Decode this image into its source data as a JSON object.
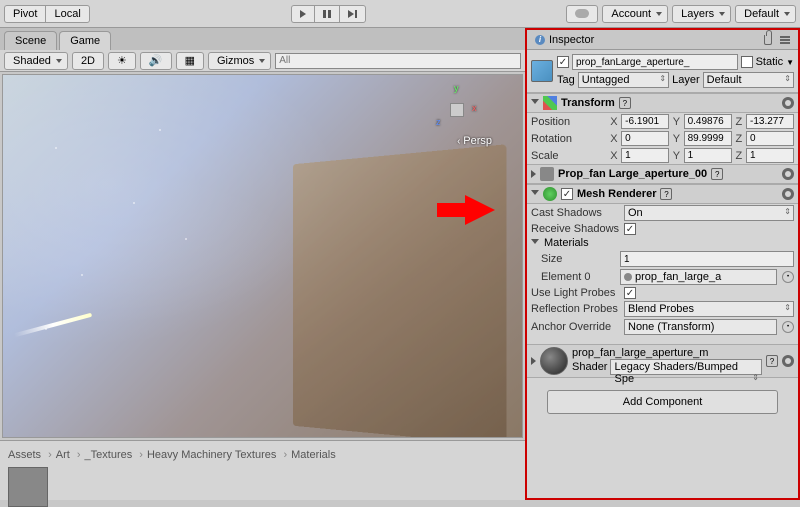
{
  "toolbar": {
    "pivot": "Pivot",
    "local": "Local",
    "account": "Account",
    "layers": "Layers",
    "layout": "Default"
  },
  "tabs": {
    "scene": "Scene",
    "game": "Game",
    "inspector": "Inspector"
  },
  "sceneBar": {
    "shaded": "Shaded",
    "mode2d": "2D",
    "gizmos": "Gizmos",
    "search": "All"
  },
  "viewport": {
    "persp": "Persp",
    "axes": {
      "x": "x",
      "y": "y",
      "z": "z"
    }
  },
  "breadcrumb": [
    "Assets",
    "Art",
    "_Textures",
    "Heavy Machinery Textures",
    "Materials"
  ],
  "inspector": {
    "object": {
      "enabled": true,
      "name": "prop_fanLarge_aperture_",
      "static_label": "Static",
      "static": false,
      "tag_label": "Tag",
      "tag": "Untagged",
      "layer_label": "Layer",
      "layer": "Default"
    },
    "transform": {
      "title": "Transform",
      "position_label": "Position",
      "position": {
        "x": "-6.1901",
        "y": "0.49876",
        "z": "-13.277"
      },
      "rotation_label": "Rotation",
      "rotation": {
        "x": "0",
        "y": "89.9999",
        "z": "0"
      },
      "scale_label": "Scale",
      "scale": {
        "x": "1",
        "y": "1",
        "z": "1"
      }
    },
    "meshFilter": {
      "title": "Prop_fan Large_aperture_00"
    },
    "meshRenderer": {
      "title": "Mesh Renderer",
      "enabled": true,
      "cast_shadows_label": "Cast Shadows",
      "cast_shadows": "On",
      "receive_shadows_label": "Receive Shadows",
      "receive_shadows": true,
      "materials_label": "Materials",
      "size_label": "Size",
      "size": "1",
      "element0_label": "Element 0",
      "element0": "prop_fan_large_a",
      "light_probes_label": "Use Light Probes",
      "light_probes": true,
      "reflection_label": "Reflection Probes",
      "reflection": "Blend Probes",
      "anchor_label": "Anchor Override",
      "anchor": "None (Transform)"
    },
    "material": {
      "name": "prop_fan_large_aperture_m",
      "shader_label": "Shader",
      "shader": "Legacy Shaders/Bumped Spe"
    },
    "add_component": "Add Component"
  }
}
